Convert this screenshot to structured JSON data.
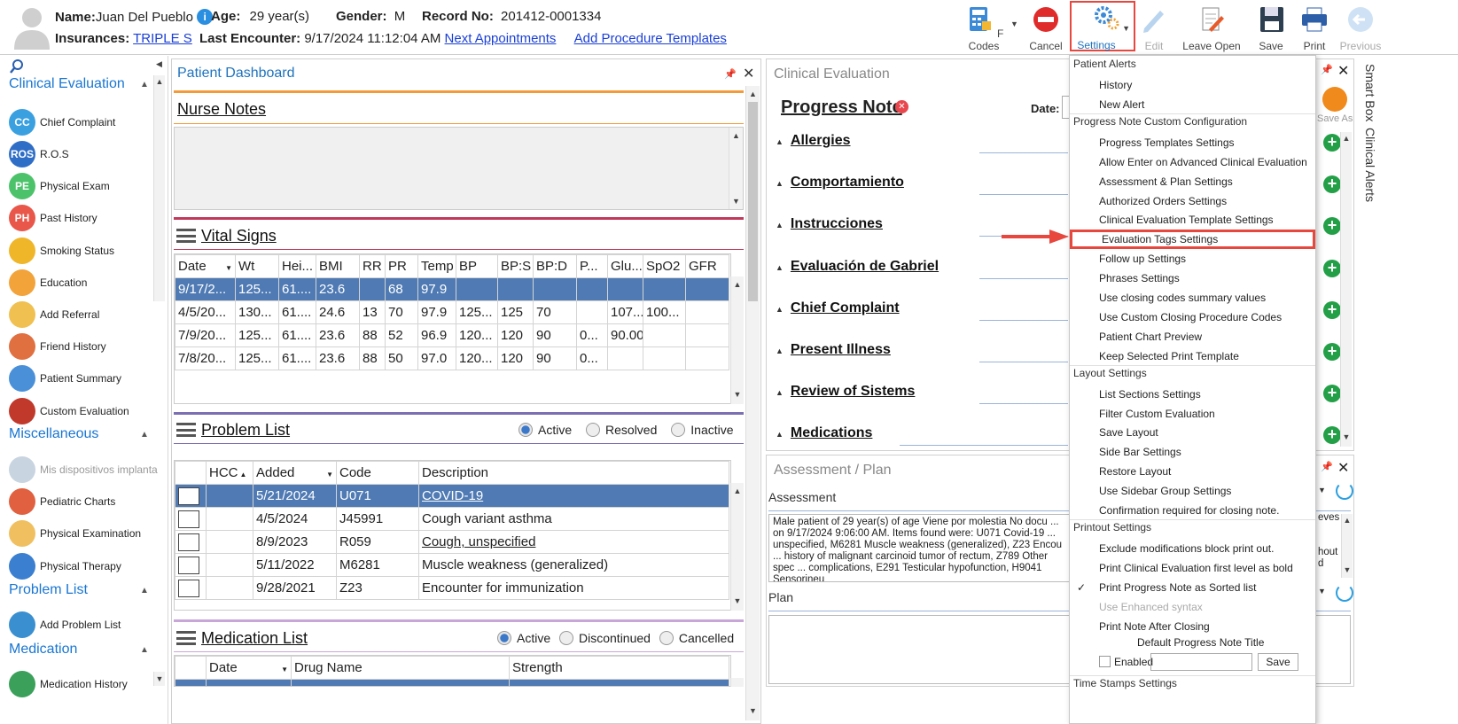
{
  "header": {
    "name_label": "Name:",
    "name": "Juan Del Pueblo",
    "age_label": "Age:",
    "age": "29 year(s)",
    "gender_label": "Gender:",
    "gender": "M",
    "record_label": "Record No:",
    "record": "201412-0001334",
    "ins_label": "Insurances:",
    "insurance": "TRIPLE S",
    "last_label": "Last Encounter:",
    "last_encounter": "9/17/2024 11:12:04 AM",
    "next_link": "Next Appointments",
    "proc_link": "Add Procedure Templates"
  },
  "toolbar": {
    "fcodes": "F Codes",
    "cancel": "Cancel",
    "settings": "Settings",
    "edit": "Edit",
    "leave_open": "Leave Open",
    "save": "Save",
    "print": "Print",
    "previous": "Previous"
  },
  "sidebar": {
    "sections": [
      {
        "title": "Clinical Evaluation",
        "items": [
          {
            "label": "Chief Complaint",
            "badge": "CC",
            "color": "#3aa0e0"
          },
          {
            "label": "R.O.S",
            "badge": "ROS",
            "color": "#2f6ec7"
          },
          {
            "label": "Physical Exam",
            "badge": "PE",
            "color": "#4cc36a"
          },
          {
            "label": "Past History",
            "badge": "PH",
            "color": "#e8574a"
          },
          {
            "label": "Smoking Status",
            "badge": "",
            "color": "#f0b62a"
          },
          {
            "label": "Education",
            "badge": "",
            "color": "#f2a33a"
          },
          {
            "label": "Add Referral",
            "badge": "",
            "color": "#f0c050"
          },
          {
            "label": "Friend History",
            "badge": "",
            "color": "#e07040"
          },
          {
            "label": "Patient Summary",
            "badge": "",
            "color": "#4a90d9"
          },
          {
            "label": "Custom Evaluation",
            "badge": "",
            "color": "#c0392b"
          }
        ]
      },
      {
        "title": "Miscellaneous",
        "items": [
          {
            "label": "Mis dispositivos implanta",
            "badge": "",
            "color": "#c8d4e0"
          },
          {
            "label": "Pediatric Charts",
            "badge": "",
            "color": "#e06040"
          },
          {
            "label": "Physical Examination",
            "badge": "",
            "color": "#f0c060"
          },
          {
            "label": "Physical Therapy",
            "badge": "",
            "color": "#3a7fd0"
          }
        ]
      },
      {
        "title": "Problem List",
        "items": [
          {
            "label": "Add Problem List",
            "badge": "",
            "color": "#3a8fd0"
          }
        ]
      },
      {
        "title": "Medication",
        "items": [
          {
            "label": "Medication History",
            "badge": "",
            "color": "#3aa05a"
          }
        ]
      }
    ]
  },
  "dashboard": {
    "title": "Patient Dashboard",
    "nurse_notes": "Nurse Notes",
    "vital_signs": "Vital Signs",
    "vitals_cols": [
      "Date",
      "Wt",
      "Hei...",
      "BMI",
      "RR",
      "PR",
      "Temp",
      "BP",
      "BP:S",
      "BP:D",
      "P...",
      "Glu...",
      "SpO2",
      "GFR"
    ],
    "vitals_rows": [
      [
        "9/17/2...",
        "125...",
        "61....",
        "23.6",
        "",
        "68",
        "97.9",
        "",
        "",
        "",
        "",
        "",
        "",
        ""
      ],
      [
        "4/5/20...",
        "130...",
        "61....",
        "24.6",
        "13",
        "70",
        "97.9",
        "125...",
        "125",
        "70",
        "",
        "107...",
        "100...",
        ""
      ],
      [
        "7/9/20...",
        "125...",
        "61....",
        "23.6",
        "88",
        "52",
        "96.9",
        "120...",
        "120",
        "90",
        "0...",
        "90.00",
        "",
        ""
      ],
      [
        "7/8/20...",
        "125...",
        "61....",
        "23.6",
        "88",
        "50",
        "97.0",
        "120...",
        "120",
        "90",
        "0...",
        "",
        "",
        ""
      ]
    ],
    "problem_list": "Problem List",
    "pl_active": "Active",
    "pl_resolved": "Resolved",
    "pl_inactive": "Inactive",
    "problem_cols": [
      "",
      "HCC",
      "Added",
      "Code",
      "Description"
    ],
    "problem_rows": [
      {
        "added": "5/21/2024",
        "code": "U071",
        "desc": "COVID-19",
        "link": true
      },
      {
        "added": "4/5/2024",
        "code": "J45991",
        "desc": "Cough variant asthma",
        "link": false
      },
      {
        "added": "8/9/2023",
        "code": "R059",
        "desc": "Cough, unspecified",
        "link": true
      },
      {
        "added": "5/11/2022",
        "code": "M6281",
        "desc": "Muscle weakness (generalized)",
        "link": false
      },
      {
        "added": "9/28/2021",
        "code": "Z23",
        "desc": "Encounter for immunization",
        "link": false
      }
    ],
    "medication_list": "Medication List",
    "ml_active": "Active",
    "ml_discontinued": "Discontinued",
    "ml_cancelled": "Cancelled",
    "med_cols": [
      "",
      "Date",
      "Drug Name",
      "Strength"
    ]
  },
  "clinical": {
    "title": "Clinical Evaluation",
    "progress_note": "Progress Note",
    "date_label": "Date:",
    "save_as": "Save As",
    "sections": [
      "Allergies",
      "Comportamiento",
      "Instrucciones",
      "Evaluación de Gabriel",
      "Chief Complaint",
      "Present Illness",
      "Review of Sistems",
      "Medications"
    ]
  },
  "assessment": {
    "title": "Assessment / Plan",
    "assessment_label": "Assessment",
    "plan_label": "Plan",
    "text": "Male patient of 29 year(s) of age Viene por molestia     No docu ... on 9/17/2024 9:06:00 AM.    Items found were:  U071 Covid-19 ... unspecified, M6281 Muscle weakness (generalized), Z23 Encou ... history of malignant carcinoid tumor of rectum, Z789 Other spec ... complications, E291 Testicular hypofunction, H9041 Sensorineu",
    "right_fragments": [
      "eves",
      "hout",
      "d"
    ]
  },
  "side_tabs": {
    "smart_box": "Smart Box",
    "clinical_alerts": "Clinical Alerts"
  },
  "menu": {
    "h_patient_alerts": "Patient Alerts",
    "history": "History",
    "new_alert": "New Alert",
    "h_progress": "Progress Note Custom Configuration",
    "progress_items": [
      "Progress Templates Settings",
      "Allow Enter on Advanced Clinical Evaluation",
      "Assessment & Plan Settings",
      "Authorized Orders Settings",
      "Clinical Evaluation Template Settings",
      "Evaluation Tags Settings",
      "Follow up Settings",
      "Phrases Settings",
      "Use closing codes summary values",
      "Use Custom Closing Procedure Codes",
      "Patient Chart Preview",
      "Keep Selected Print Template"
    ],
    "h_layout": "Layout Settings",
    "layout_items": [
      "List Sections Settings",
      "Filter Custom Evaluation",
      "Save Layout",
      "Side Bar Settings",
      "Restore Layout",
      "Use Sidebar Group Settings",
      "Confirmation required for closing note."
    ],
    "h_printout": "Printout Settings",
    "printout_items": [
      "Exclude modifications block print out.",
      "Print Clinical Evaluation first level as bold",
      "Print Progress Note as Sorted list",
      "Use Enhanced syntax",
      "Print Note After Closing"
    ],
    "default_title": "Default Progress Note Title",
    "enabled": "Enabled",
    "save": "Save",
    "h_timestamps": "Time Stamps Settings"
  },
  "colors": {
    "accent": "#1e73be",
    "highlight": "#e8473e",
    "selected": "#4f7ab3"
  }
}
